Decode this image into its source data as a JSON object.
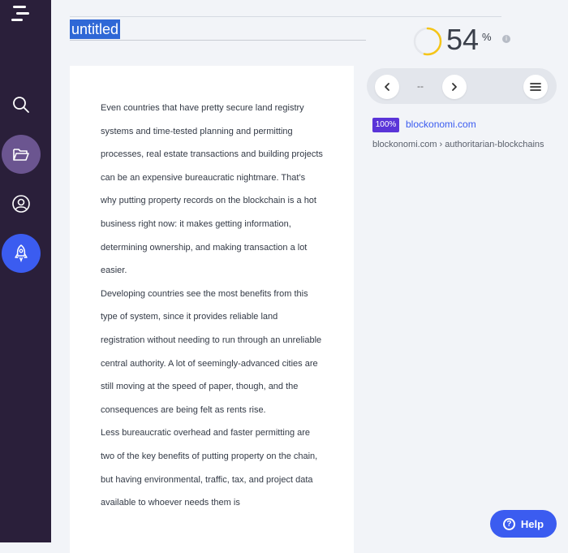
{
  "document": {
    "title": "untitled",
    "paragraphs": [
      "Even countries that have pretty secure land registry systems and time-tested planning and permitting processes, real estate transactions and building projects can be an expensive bureaucratic nightmare. That’s why putting property records on the blockchain is a hot business right now: it makes getting information, determining ownership, and making transaction a lot easier.",
      "Developing countries see the most benefits from this type of system, since it provides reliable land registration without needing to run through an unreliable central authority. A lot of seemingly-advanced cities are still moving at the speed of paper, though, and the consequences are being felt as rents rise.",
      "Less bureaucratic overhead and faster permitting are two of the key benefits of putting property on the chain, but having environmental, traffic, tax, and project data available to whoever needs them is"
    ]
  },
  "score": {
    "value": "54",
    "unit": "%",
    "info_icon": "info-icon",
    "ring_fraction": 0.54,
    "ring_color": "#f5c518"
  },
  "source_nav": {
    "pager_text": "--",
    "prev_icon": "chevron-left-icon",
    "next_icon": "chevron-right-icon",
    "menu_icon": "hamburger-menu-icon"
  },
  "source": {
    "match_badge": "100%",
    "domain": "blockonomi.com",
    "path": "blockonomi.com › authoritarian-blockchains"
  },
  "sidebar": {
    "items": [
      {
        "icon": "search-icon"
      },
      {
        "icon": "folder-open-icon",
        "active": true
      },
      {
        "icon": "user-icon"
      },
      {
        "icon": "rocket-icon",
        "highlight": true
      }
    ]
  },
  "help": {
    "label": "Help",
    "icon": "question-icon"
  },
  "colors": {
    "sidebar_bg": "#2a1f3a",
    "accent_blue": "#3b5cf0",
    "badge_purple": "#5a34d8",
    "selection": "#2f68d6"
  }
}
